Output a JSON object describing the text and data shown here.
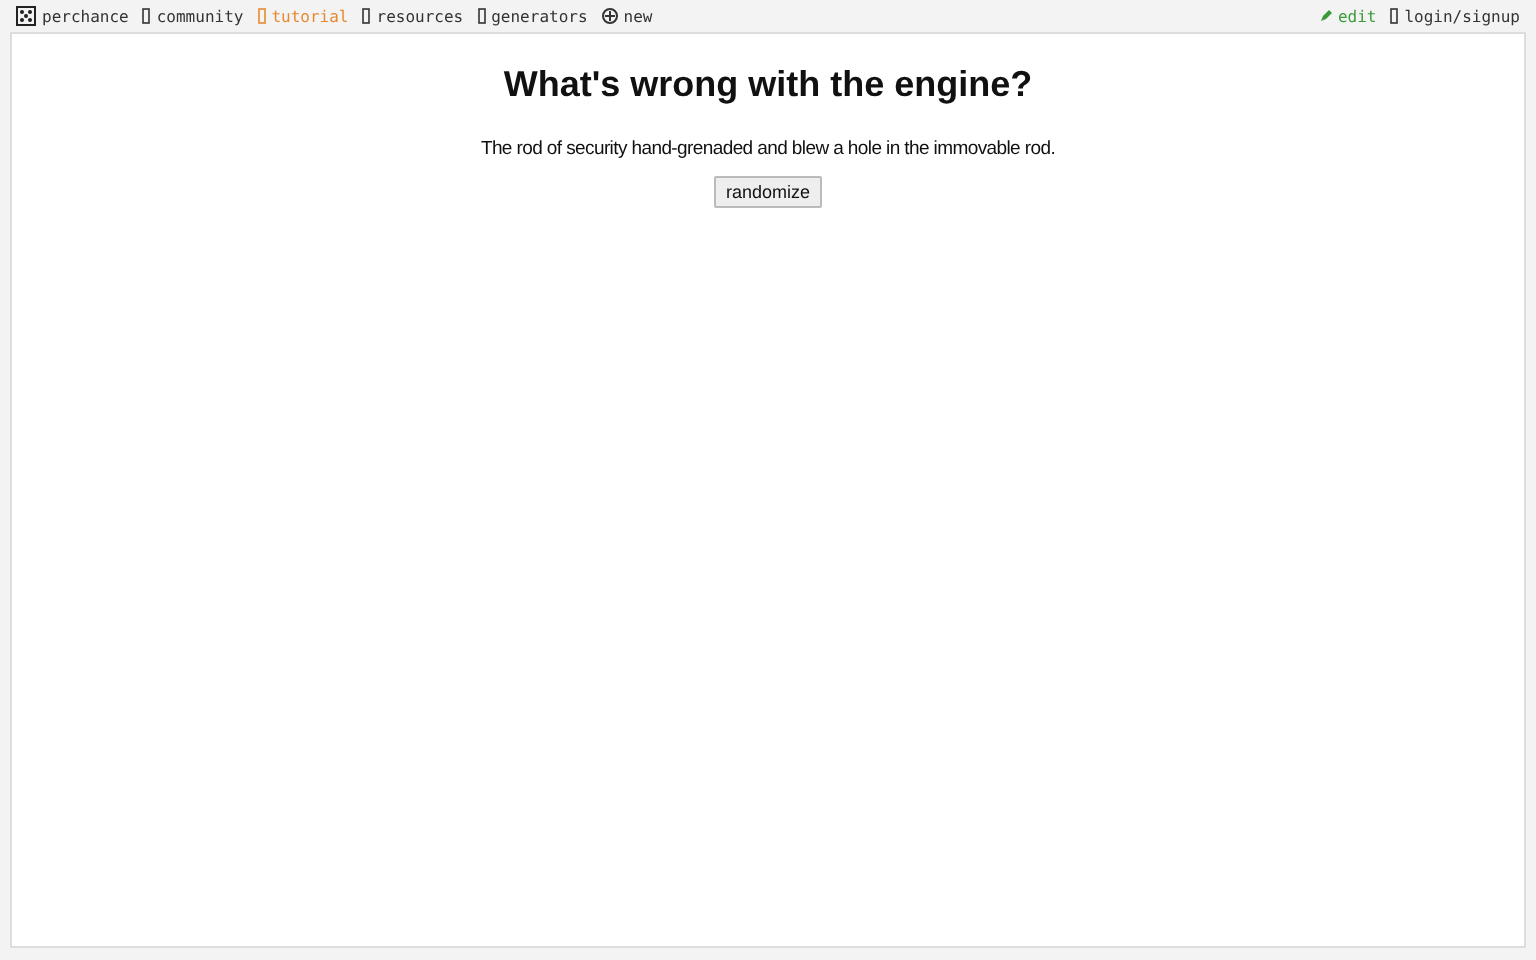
{
  "nav_left": [
    {
      "kind": "dice",
      "label": "perchance",
      "color": "#333333"
    },
    {
      "kind": "box",
      "label": "community",
      "color": "#333333"
    },
    {
      "kind": "box",
      "label": "tutorial",
      "color": "#e8892f"
    },
    {
      "kind": "box",
      "label": "resources",
      "color": "#333333"
    },
    {
      "kind": "box",
      "label": "generators",
      "color": "#333333"
    },
    {
      "kind": "plus",
      "label": "new",
      "color": "#333333"
    }
  ],
  "nav_right": [
    {
      "kind": "pencil",
      "label": "edit",
      "color": "#3a9a3a"
    },
    {
      "kind": "box",
      "label": "login/signup",
      "color": "#333333"
    }
  ],
  "heading": "What's wrong with the engine?",
  "result": "The rod of security hand-grenaded and blew a hole in the immovable rod.",
  "button": "randomize"
}
